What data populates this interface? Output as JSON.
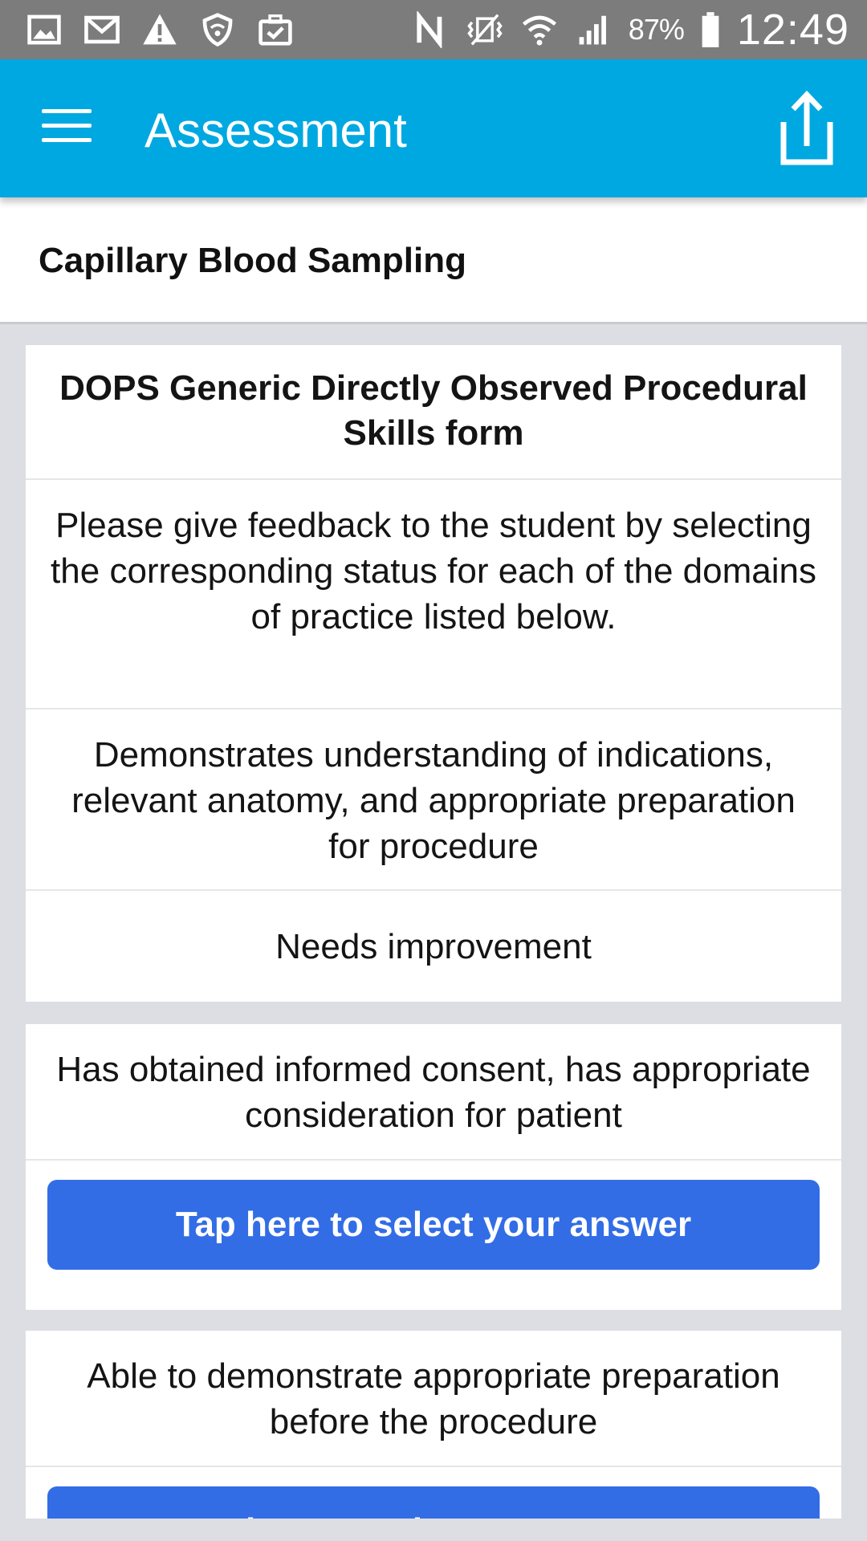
{
  "status_bar": {
    "battery_percent": "87%",
    "time": "12:49",
    "icons": [
      "gallery-icon",
      "gmail-icon",
      "warning-icon",
      "vpn-shield-icon",
      "briefcase-check-icon",
      "nfc-icon",
      "vibrate-icon",
      "wifi-icon",
      "signal-icon",
      "battery-icon"
    ]
  },
  "app_bar": {
    "title": "Assessment",
    "menu_icon": "hamburger-menu-icon",
    "share_icon": "share-icon"
  },
  "subheader": {
    "title": "Capillary Blood Sampling"
  },
  "form": {
    "title": "DOPS Generic Directly Observed Procedural Skills form",
    "instructions": "Please give feedback to the student by selecting the corresponding status for each of the domains of practice listed below.",
    "questions": [
      {
        "text": "Demonstrates understanding of indications, relevant anatomy, and appropriate preparation for procedure",
        "answer": "Needs improvement"
      },
      {
        "text": "Has obtained informed consent, has appropriate consideration for patient",
        "button_label": "Tap here to select your answer"
      },
      {
        "text": "Able to demonstrate appropriate preparation before the procedure",
        "button_label": "Tap here to select your answer"
      }
    ]
  },
  "colors": {
    "app_bar": "#00a8e1",
    "status_bar": "#7c7c7c",
    "button": "#326de6",
    "background": "#dcdee3"
  }
}
